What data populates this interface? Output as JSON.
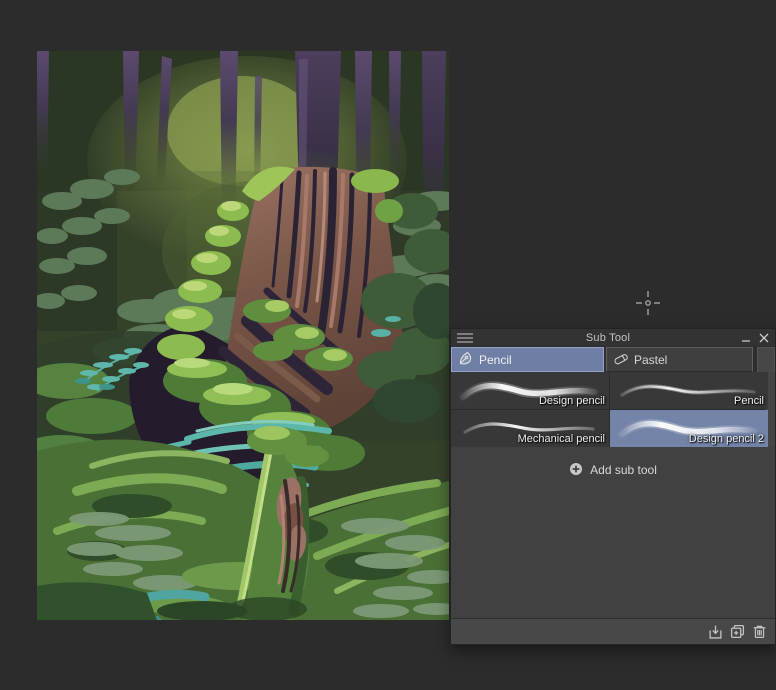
{
  "window": {
    "background_color": "#2c2c2c"
  },
  "canvas": {
    "description": "Digital painting of a mossy tree stump in a dark green forest",
    "palette": {
      "background_glow": "#87994e",
      "forest_dark": "#2e3a27",
      "trunk_purple": "#564668",
      "fern_muted_green": "#5c7a58",
      "stump_brown": "#8a675a",
      "shadow_purple": "#241c2c",
      "moss_light": "#9dc557",
      "moss_mid": "#5f8e3f",
      "teal_accent": "#5cb6aa",
      "grass_green": "#4a7036",
      "grass_light": "#7cab53",
      "sage": "#7d9a77"
    }
  },
  "subtool_panel": {
    "title": "Sub Tool",
    "accent_color": "#7484a8",
    "tabs": [
      {
        "label": "Pencil",
        "icon": "pen-nib-icon",
        "selected": true
      },
      {
        "label": "Pastel",
        "icon": "pastel-stick-icon",
        "selected": false
      }
    ],
    "brushes": [
      {
        "label": "Design pencil",
        "selected": false
      },
      {
        "label": "Pencil",
        "selected": false
      },
      {
        "label": "Mechanical pencil",
        "selected": false
      },
      {
        "label": "Design pencil 2",
        "selected": true
      }
    ],
    "add_button_label": "Add sub tool",
    "footer_icons": [
      "register-sub-tool",
      "duplicate-sub-tool",
      "delete-sub-tool"
    ]
  }
}
